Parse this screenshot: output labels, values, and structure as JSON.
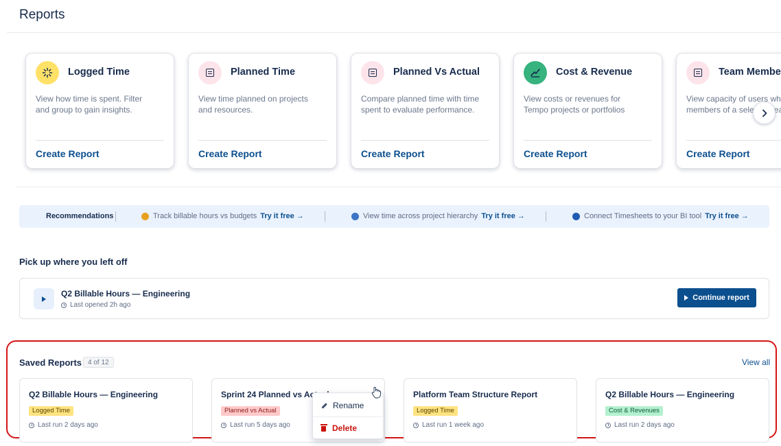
{
  "page": {
    "title": "Reports"
  },
  "report_types": [
    {
      "title": "Logged Time",
      "desc_lines": [
        "View how time is spent. Filter",
        "and group to gain insights."
      ],
      "cta": "Create Report",
      "icon": "sparkle-icon",
      "icon_bg": "#ffe168"
    },
    {
      "title": "Planned Time",
      "desc_lines": [
        "View time planned on projects",
        "and resources."
      ],
      "cta": "Create Report",
      "icon": "document-icon",
      "icon_bg": "#fde4ea"
    },
    {
      "title": "Planned Vs Actual",
      "desc_lines": [
        "Compare planned time with time",
        "spent to evaluate performance."
      ],
      "cta": "Create Report",
      "icon": "document-icon",
      "icon_bg": "#fde4ea"
    },
    {
      "title": "Cost & Revenue",
      "desc_lines": [
        "View costs or revenues for",
        "Tempo projects or portfolios"
      ],
      "cta": "Create Report",
      "icon": "trend-line-icon",
      "icon_bg": "#36b37e"
    },
    {
      "title": "Team Member Capacity",
      "desc_lines": [
        "View capacity of users who are",
        "members of a selected team"
      ],
      "cta": "Create Report",
      "icon": "document-icon",
      "icon_bg": "#fde4ea"
    }
  ],
  "recommendations": {
    "label": "Recommendations",
    "items": [
      {
        "text": "Track billable hours vs budgets",
        "action": "Try it free →",
        "dot_color": "#e8a021"
      },
      {
        "text": "View time across project hierarchy",
        "action": "Try it free →",
        "dot_color": "#3d74c4"
      },
      {
        "text": "Connect Timesheets to your BI tool",
        "action": "Try it free →",
        "dot_color": "#1f5bb3"
      }
    ]
  },
  "pickup": {
    "heading": "Pick up where you left off",
    "report_title": "Q2 Billable Hours — Engineering",
    "last_opened": "Last opened 2h ago",
    "continue_label": "Continue report"
  },
  "saved_reports": {
    "heading": "Saved Reports",
    "count": "4 of 12",
    "view_all": "View all",
    "items": [
      {
        "title": "Q2 Billable Hours — Engineering",
        "tag": "Logged Time",
        "tag_bg": "#ffe380",
        "tag_color": "#5a4400",
        "last_run": "Last run 2 days ago"
      },
      {
        "title": "Sprint 24 Planned vs Actual",
        "tag": "Planned vs Actual",
        "tag_bg": "#ffc9c9",
        "tag_color": "#8b1a1a",
        "last_run": "Last run 5 days ago"
      },
      {
        "title": "Platform Team Structure Report",
        "tag": "Logged Time",
        "tag_bg": "#ffe380",
        "tag_color": "#5a4400",
        "last_run": "Last run 1 week ago"
      },
      {
        "title": "Q2 Billable Hours — Engineering",
        "tag": "Cost & Revenues",
        "tag_bg": "#b3f0d0",
        "tag_color": "#0b5c36",
        "last_run": "Last run 2 days ago"
      }
    ]
  },
  "context_menu": {
    "rename": "Rename",
    "delete": "Delete"
  }
}
